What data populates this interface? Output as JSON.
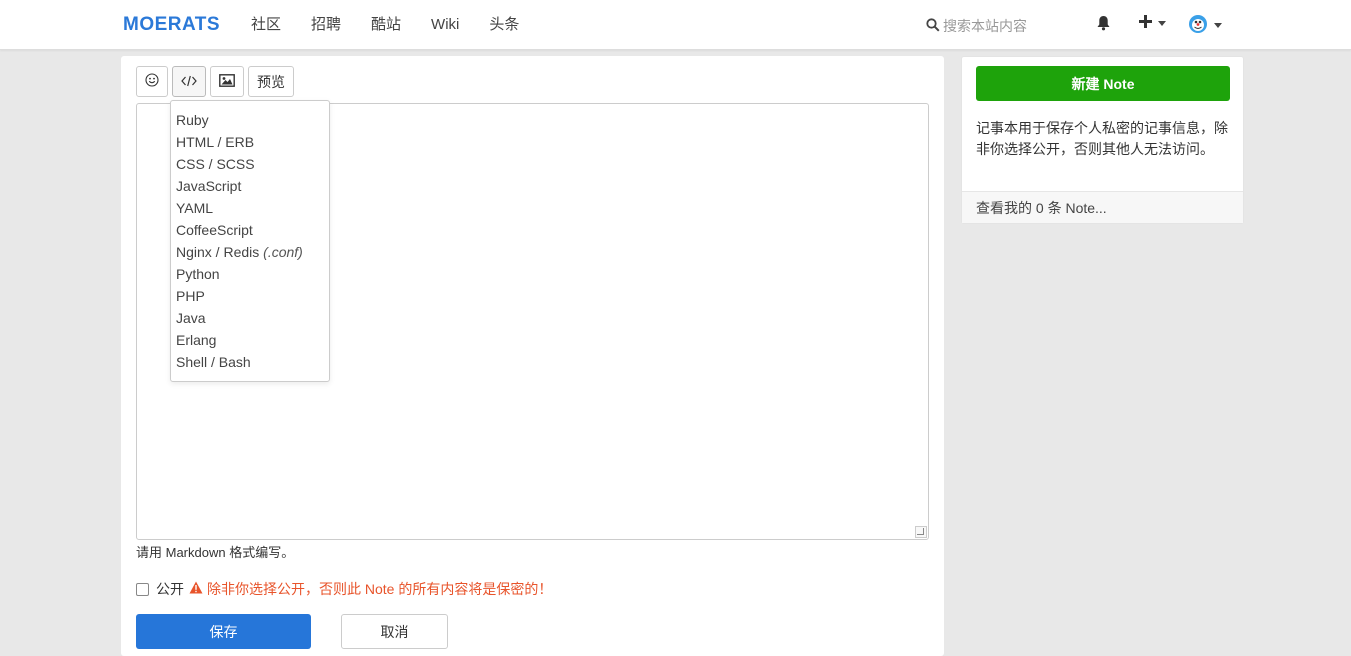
{
  "navbar": {
    "brand": "MOERATS",
    "links": [
      "社区",
      "招聘",
      "酷站",
      "Wiki",
      "头条"
    ],
    "search_placeholder": "搜索本站内容"
  },
  "toolbar": {
    "preview_label": "预览"
  },
  "code_menu": {
    "items": [
      {
        "label": "Ruby",
        "suffix": ""
      },
      {
        "label": "HTML / ERB",
        "suffix": ""
      },
      {
        "label": "CSS / SCSS",
        "suffix": ""
      },
      {
        "label": "JavaScript",
        "suffix": ""
      },
      {
        "label": "YAML",
        "suffix": ""
      },
      {
        "label": "CoffeeScript",
        "suffix": ""
      },
      {
        "label": "Nginx / Redis ",
        "suffix": "(.conf)"
      },
      {
        "label": "Python",
        "suffix": ""
      },
      {
        "label": "PHP",
        "suffix": ""
      },
      {
        "label": "Java",
        "suffix": ""
      },
      {
        "label": "Erlang",
        "suffix": ""
      },
      {
        "label": "Shell / Bash",
        "suffix": ""
      }
    ]
  },
  "editor": {
    "help_text": "请用 Markdown 格式编写。"
  },
  "public": {
    "label": "公开",
    "warning": "除非你选择公开，否则此 Note 的所有内容将是保密的！"
  },
  "actions": {
    "save": "保存",
    "cancel": "取消"
  },
  "sidebar": {
    "new_note": "新建 Note",
    "description": "记事本用于保存个人私密的记事信息，除非你选择公开，否则其他人无法访问。",
    "my_notes_link": "查看我的 0 条 Note..."
  },
  "colors": {
    "brand": "#2b79d8",
    "primary": "#2676d9",
    "success": "#1ea30b",
    "warning": "#e8542b"
  }
}
